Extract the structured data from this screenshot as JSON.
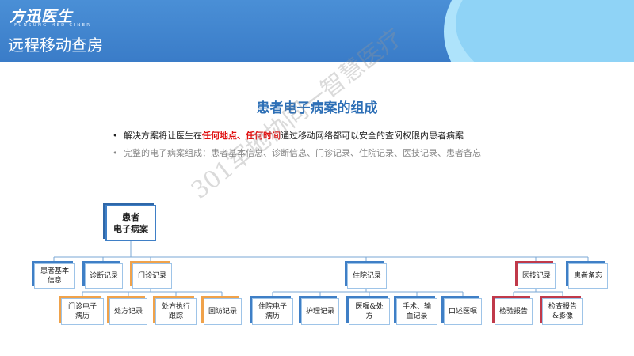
{
  "header": {
    "logo": "方迅医生",
    "logo_sub": "FUNSUNG MEDICINER",
    "page_title": "远程移动查房"
  },
  "slide": {
    "title": "患者电子病案的组成",
    "bullet1": {
      "pre": "解决方案将让医生在",
      "hl1": "任何地点、任何时间",
      "post": "通过移动网络都可以安全的查阅权限内患者病案"
    },
    "bullet2": "完整的电子病案组成：患者基本信息、诊断信息、门诊记录、住院记录、医技记录、患者备忘"
  },
  "watermark": "301军地协同一智慧医疗",
  "tree": {
    "root": "患者\n电子病案",
    "level1": [
      {
        "label": "患者基本\n信息",
        "accent": "blue"
      },
      {
        "label": "诊断记录",
        "accent": "blue"
      },
      {
        "label": "门诊记录",
        "accent": "orange"
      },
      {
        "label": "住院记录",
        "accent": "blue"
      },
      {
        "label": "医技记录",
        "accent": "red"
      },
      {
        "label": "患者备忘",
        "accent": "blue"
      }
    ],
    "outpatient_children": [
      "门诊电子\n病历",
      "处方记录",
      "处方执行\n跟踪",
      "回访记录"
    ],
    "inpatient_children": [
      "住院电子\n病历",
      "护理记录",
      "医嘱&处\n方",
      "手术、输\n血记录",
      "口述医嘱"
    ],
    "tech_children": [
      "检验报告",
      "检查报告\n&影像"
    ]
  },
  "colors": {
    "blue": "#3f7fc6",
    "orange": "#f0a24a",
    "red": "#c0394a",
    "title_blue": "#2d6fb6",
    "highlight_red": "#e01010"
  }
}
